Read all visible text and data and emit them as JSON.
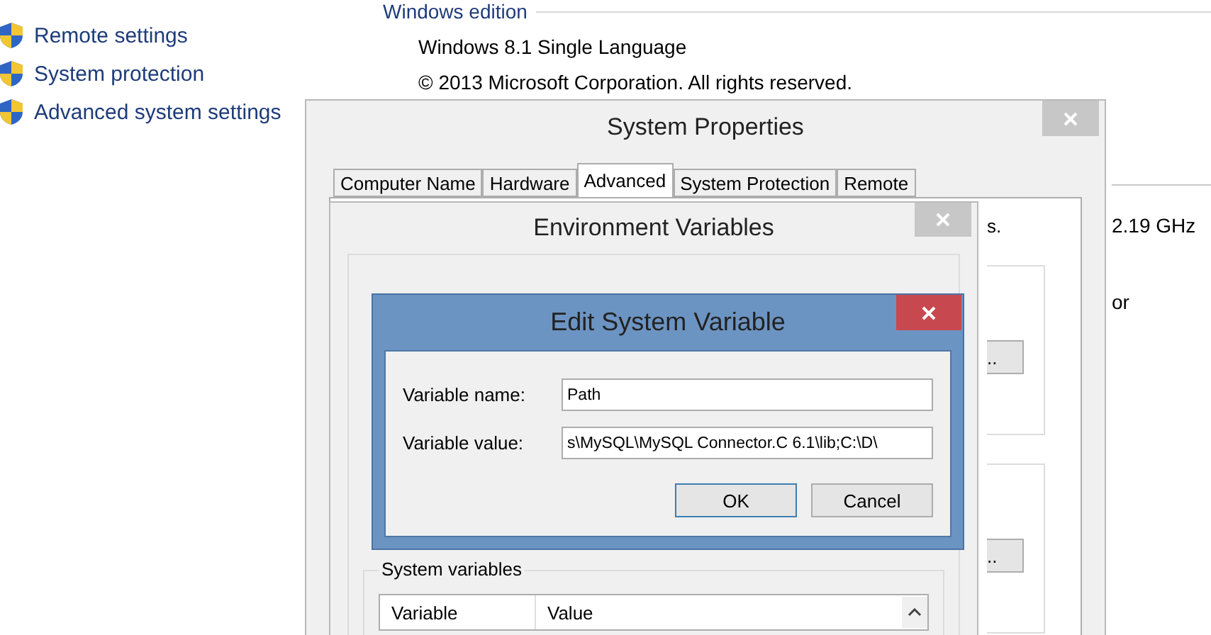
{
  "background_page": {
    "sidebar_links": [
      "Remote settings",
      "System protection",
      "Advanced system settings"
    ],
    "windows_edition": {
      "heading": "Windows edition",
      "edition": "Windows 8.1 Single Language",
      "copyright": "© 2013 Microsoft Corporation. All rights reserved."
    },
    "processor_speed": "2.19 GHz",
    "cut_text": "or"
  },
  "system_properties": {
    "title": "System Properties",
    "tabs": [
      {
        "label": "Computer Name",
        "selected": false
      },
      {
        "label": "Hardware",
        "selected": false
      },
      {
        "label": "Advanced",
        "selected": true
      },
      {
        "label": "System Protection",
        "selected": false
      },
      {
        "label": "Remote",
        "selected": false
      }
    ],
    "panel_text": "s.",
    "buttons": [
      "..",
      ".."
    ]
  },
  "environment_variables": {
    "title": "Environment Variables",
    "system_variables": {
      "heading": "System variables",
      "columns": [
        "Variable",
        "Value"
      ]
    }
  },
  "edit_dialog": {
    "title": "Edit System Variable",
    "fields": [
      {
        "label": "Variable name:",
        "value": "Path"
      },
      {
        "label": "Variable value:",
        "value": "s\\MySQL\\MySQL Connector.C 6.1\\lib;C:\\D\\"
      }
    ],
    "buttons": [
      {
        "label": "OK",
        "default": true
      },
      {
        "label": "Cancel",
        "default": false
      }
    ]
  }
}
